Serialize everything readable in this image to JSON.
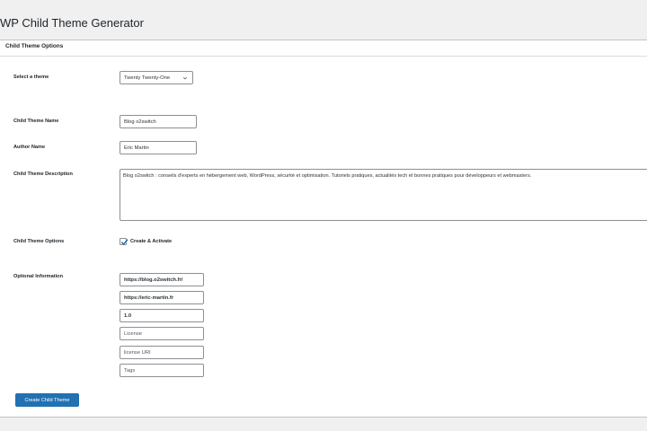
{
  "header": {
    "title": "WP Child Theme Generator"
  },
  "panel": {
    "title": "Child Theme Options"
  },
  "form": {
    "select_theme": {
      "label": "Select a theme",
      "selected": "Twenty Twenty-One"
    },
    "child_theme_name": {
      "label": "Child Theme Name",
      "value": "Blog o2switch"
    },
    "author_name": {
      "label": "Author Name",
      "value": "Eric Martin"
    },
    "description": {
      "label": "Child Theme Description",
      "value": "Blog o2switch : conseils d'experts en hébergement web, WordPress, sécurité et optimisation. Tutoriels pratiques, actualités tech et bonnes pratiques pour développeurs et webmasters."
    },
    "options": {
      "label": "Child Theme Options",
      "checkbox_label": "Create & Activate",
      "checked": true
    },
    "optional": {
      "label": "Optional Information",
      "theme_uri": "https://blog.o2switch.fr/",
      "author_uri": "https://eric-martin.fr",
      "version": "1.0",
      "license_placeholder": "License",
      "license_uri_placeholder": "license URI",
      "tags_placeholder": "Tags"
    },
    "submit_label": "Create Child Theme"
  },
  "colors": {
    "primary": "#2271b1",
    "background": "#f0f0f1",
    "panel": "#ffffff"
  }
}
